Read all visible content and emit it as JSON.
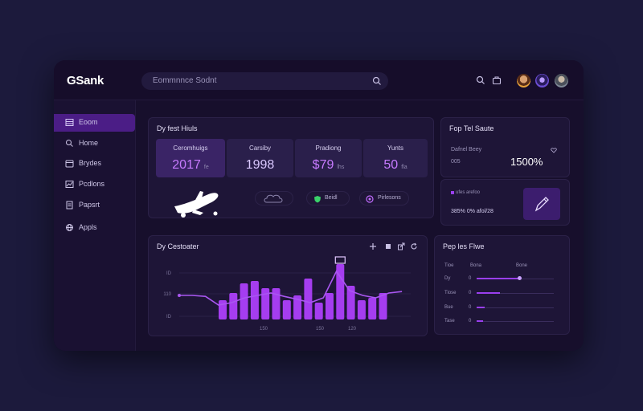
{
  "app": {
    "logo": "Sank"
  },
  "search": {
    "placeholder": "Eommnnce Sodnt"
  },
  "sidebar": {
    "items": [
      {
        "label": "Eoom",
        "icon": "table-icon",
        "active": true
      },
      {
        "label": "Home",
        "icon": "search-icon"
      },
      {
        "label": "Brydes",
        "icon": "calendar-icon"
      },
      {
        "label": "Pcdlons",
        "icon": "chart-icon"
      },
      {
        "label": "Papsrt",
        "icon": "document-icon"
      },
      {
        "label": "Appls",
        "icon": "globe-icon"
      }
    ]
  },
  "stats_panel": {
    "title": "Dy fest Hiuls",
    "cards": [
      {
        "label": "Ceromhuigs",
        "value": "2017",
        "suffix": "fe"
      },
      {
        "label": "Carsiby",
        "value": "1998",
        "suffix": ""
      },
      {
        "label": "Pradiong",
        "value": "$79",
        "suffix": "lhs"
      },
      {
        "label": "Yunts",
        "value": "50",
        "suffix": "fla"
      }
    ],
    "chips": [
      {
        "label": "Beidl",
        "icon": "shield-icon"
      },
      {
        "label": "Pirlesons",
        "icon": "target-icon"
      }
    ]
  },
  "top_panel": {
    "title": "Fop Tel Saute",
    "label": "Dafnel Beey",
    "sub": "005",
    "value": "1500%",
    "secondary_label": "ufes arefoo",
    "secondary_value": "385% 0% afol/28"
  },
  "chart_panel": {
    "title": "Dy Cestoater",
    "toolbar": [
      "plus-icon",
      "square-icon",
      "share-icon",
      "refresh-icon"
    ]
  },
  "chart_data": {
    "type": "bar",
    "title": "Dy Cestoater",
    "y_tick_labels": [
      "ID",
      "110",
      "ID"
    ],
    "x_tick_labels": [
      "150",
      "150",
      "120"
    ],
    "values": [
      4,
      5.5,
      7.5,
      8,
      6.5,
      6.5,
      4,
      5,
      8.5,
      3.5,
      5.5,
      11.5,
      7,
      4,
      4.5,
      5.5
    ],
    "line": [
      5,
      5,
      4.8,
      3,
      3.5,
      4.5,
      5,
      5.5,
      4.8,
      4.2,
      3.5,
      4.5,
      10,
      6,
      5,
      4.5,
      5.5,
      5.8
    ],
    "ylim": [
      0,
      13
    ],
    "highlight_index": 11,
    "bar_color": "#a53df0",
    "line_color": "#a957f0",
    "grid": true
  },
  "bottom_right": {
    "title": "Pep les Flwe",
    "headers": [
      "Tioe",
      "Bona",
      "Bone"
    ],
    "rows": [
      {
        "label": "Dy",
        "sub": "0",
        "value": 0.55
      },
      {
        "label": "Tiose",
        "sub": "0",
        "value": 0.3
      },
      {
        "label": "Bue",
        "sub": "0",
        "value": 0.1
      },
      {
        "label": "Tase",
        "sub": "0",
        "value": 0.08
      }
    ],
    "accent": "#9a3ff0"
  }
}
